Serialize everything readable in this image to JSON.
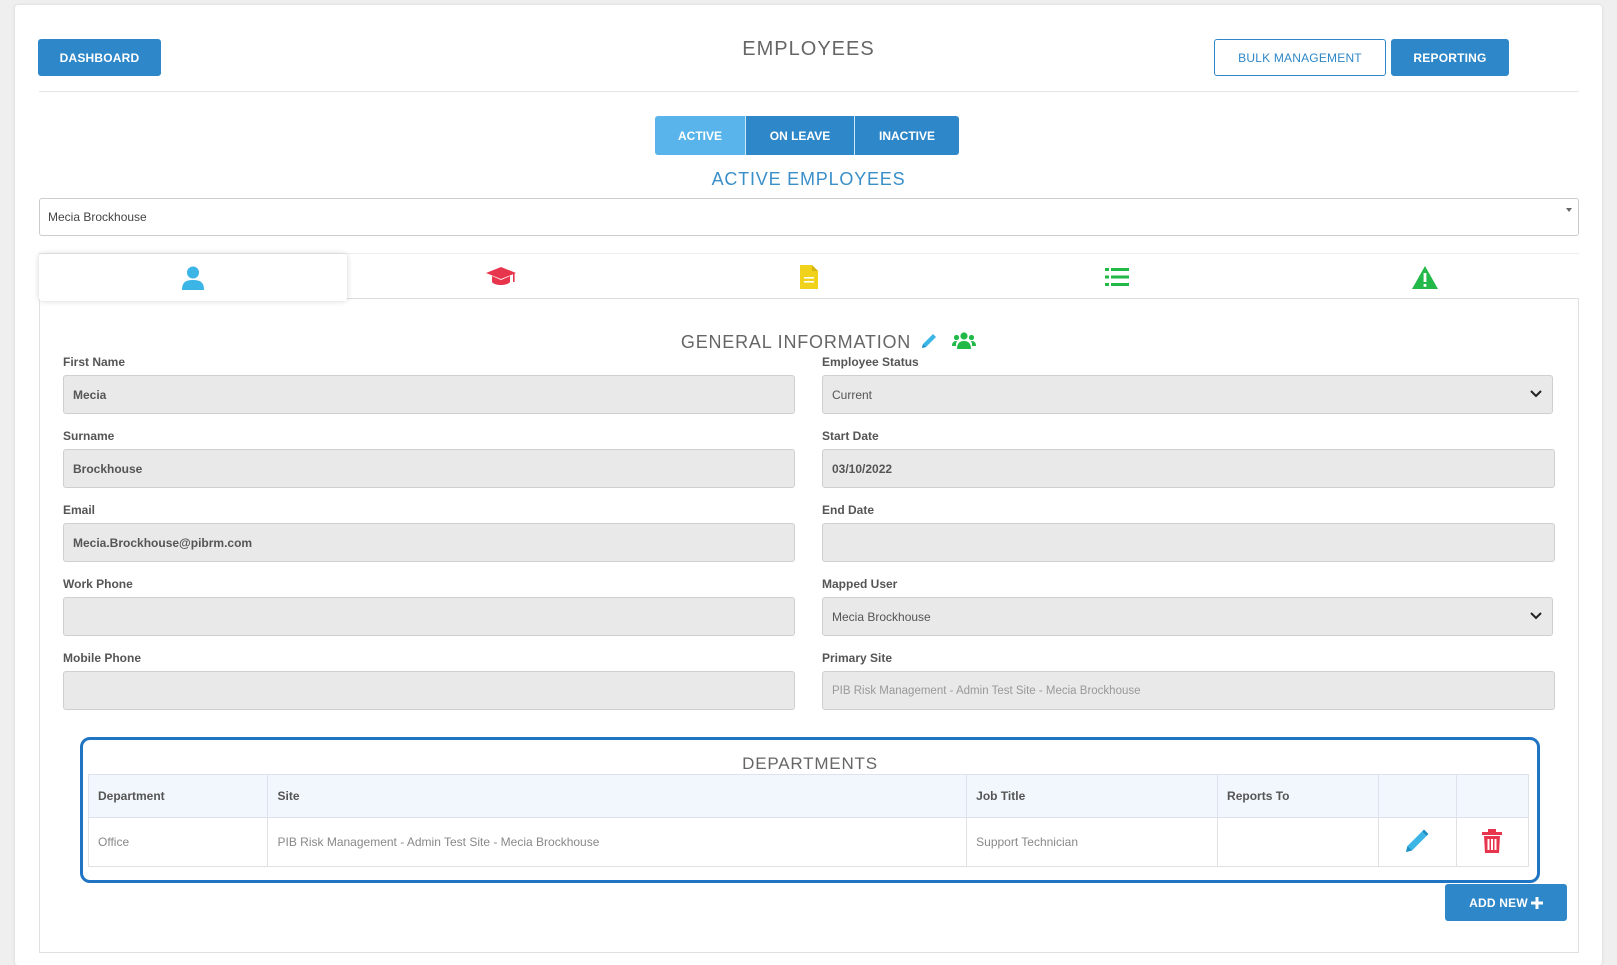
{
  "header": {
    "dashboard_label": "DASHBOARD",
    "title": "EMPLOYEES",
    "bulk_label": "BULK MANAGEMENT",
    "reporting_label": "REPORTING"
  },
  "status_tabs": [
    {
      "label": "ACTIVE",
      "active": true
    },
    {
      "label": "ON LEAVE",
      "active": false
    },
    {
      "label": "INACTIVE",
      "active": false
    }
  ],
  "section_title": "ACTIVE EMPLOYEES",
  "employee_select": {
    "value": "Mecia Brockhouse"
  },
  "icon_tabs": [
    {
      "icon": "user-icon",
      "color": "#3bb4e6",
      "selected": true
    },
    {
      "icon": "graduation-cap-icon",
      "color": "#e8354e",
      "selected": false
    },
    {
      "icon": "document-icon",
      "color": "#f1d21b",
      "selected": false
    },
    {
      "icon": "list-icon",
      "color": "#23b949",
      "selected": false
    },
    {
      "icon": "warning-icon",
      "color": "#23b949",
      "selected": false
    }
  ],
  "general": {
    "title": "GENERAL INFORMATION",
    "edit_icon_color": "#3bb4e6",
    "group_icon_color": "#23b949",
    "first_name": {
      "label": "First Name",
      "value": "Mecia"
    },
    "surname": {
      "label": "Surname",
      "value": "Brockhouse"
    },
    "email": {
      "label": "Email",
      "value": "Mecia.Brockhouse@pibrm.com"
    },
    "work_phone": {
      "label": "Work Phone",
      "value": ""
    },
    "mobile_phone": {
      "label": "Mobile Phone",
      "value": ""
    },
    "employee_status": {
      "label": "Employee Status",
      "value": "Current"
    },
    "start_date": {
      "label": "Start Date",
      "value": "03/10/2022"
    },
    "end_date": {
      "label": "End Date",
      "value": ""
    },
    "mapped_user": {
      "label": "Mapped User",
      "value": "Mecia Brockhouse"
    },
    "primary_site": {
      "label": "Primary Site",
      "value": "PIB Risk Management - Admin Test Site - Mecia Brockhouse"
    }
  },
  "departments": {
    "title": "DEPARTMENTS",
    "columns": [
      "Department",
      "Site",
      "Job Title",
      "Reports To",
      "",
      ""
    ],
    "rows": [
      {
        "department": "Office",
        "site": "PIB Risk Management - Admin Test Site - Mecia Brockhouse",
        "job_title": "Support Technician",
        "reports_to": ""
      }
    ],
    "add_new_label": "ADD NEW"
  },
  "colors": {
    "primary": "#2e87c8",
    "active_tab": "#5ab4ec",
    "highlight_border": "#1f74c4",
    "delete": "#e8354e"
  }
}
